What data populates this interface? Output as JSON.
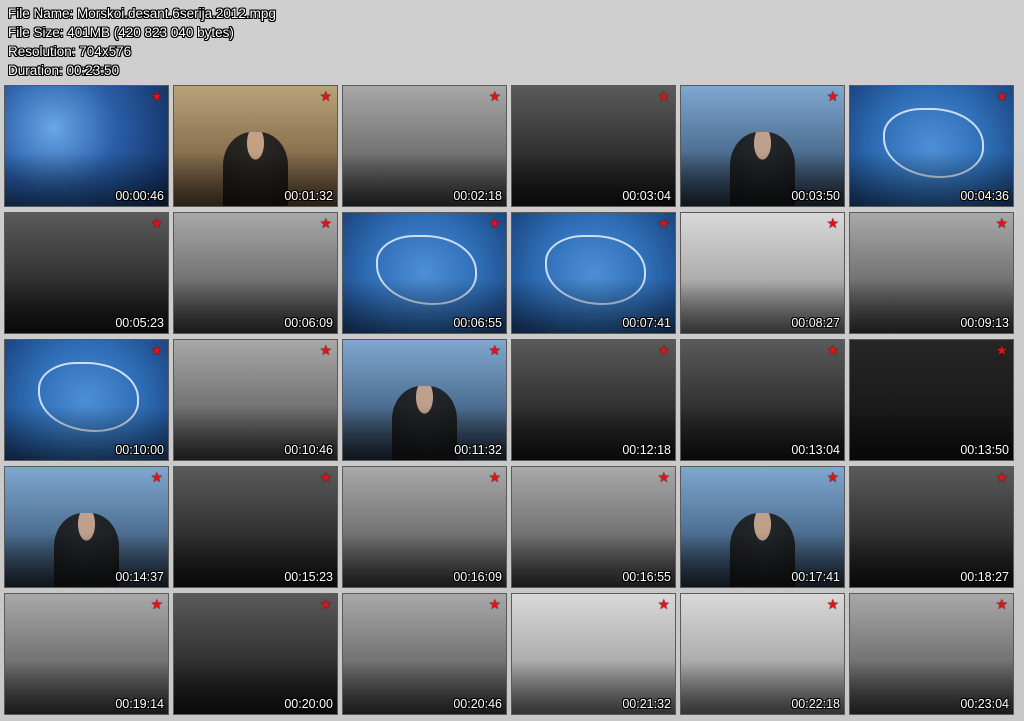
{
  "file_info": {
    "name": "File Name: Morskoi.desant.6serija.2012.mpg",
    "size": "File Size: 401MB (420 823 040 bytes)",
    "resolution": "Resolution: 704x576",
    "duration": "Duration: 00:23:50"
  },
  "thumbnails": [
    {
      "time": "00:00:46",
      "scene": "t-blue"
    },
    {
      "time": "00:01:32",
      "scene": "t-sepia"
    },
    {
      "time": "00:02:18",
      "scene": "t-gray"
    },
    {
      "time": "00:03:04",
      "scene": "t-dark"
    },
    {
      "time": "00:03:50",
      "scene": "t-studio"
    },
    {
      "time": "00:04:36",
      "scene": "t-map"
    },
    {
      "time": "00:05:23",
      "scene": "t-dark"
    },
    {
      "time": "00:06:09",
      "scene": "t-gray"
    },
    {
      "time": "00:06:55",
      "scene": "t-map"
    },
    {
      "time": "00:07:41",
      "scene": "t-map"
    },
    {
      "time": "00:08:27",
      "scene": "t-light"
    },
    {
      "time": "00:09:13",
      "scene": "t-gray"
    },
    {
      "time": "00:10:00",
      "scene": "t-map"
    },
    {
      "time": "00:10:46",
      "scene": "t-gray"
    },
    {
      "time": "00:11:32",
      "scene": "t-studio"
    },
    {
      "time": "00:12:18",
      "scene": "t-dark"
    },
    {
      "time": "00:13:04",
      "scene": "t-dark"
    },
    {
      "time": "00:13:50",
      "scene": "t-black"
    },
    {
      "time": "00:14:37",
      "scene": "t-studio"
    },
    {
      "time": "00:15:23",
      "scene": "t-dark"
    },
    {
      "time": "00:16:09",
      "scene": "t-gray"
    },
    {
      "time": "00:16:55",
      "scene": "t-gray"
    },
    {
      "time": "00:17:41",
      "scene": "t-studio"
    },
    {
      "time": "00:18:27",
      "scene": "t-dark"
    },
    {
      "time": "00:19:14",
      "scene": "t-gray"
    },
    {
      "time": "00:20:00",
      "scene": "t-dark"
    },
    {
      "time": "00:20:46",
      "scene": "t-gray"
    },
    {
      "time": "00:21:32",
      "scene": "t-light"
    },
    {
      "time": "00:22:18",
      "scene": "t-light"
    },
    {
      "time": "00:23:04",
      "scene": "t-gray"
    }
  ],
  "colors": {
    "star": "#e01414",
    "background": "#cfcfcf"
  },
  "icons": {
    "corner_badge": "red-star-icon"
  }
}
